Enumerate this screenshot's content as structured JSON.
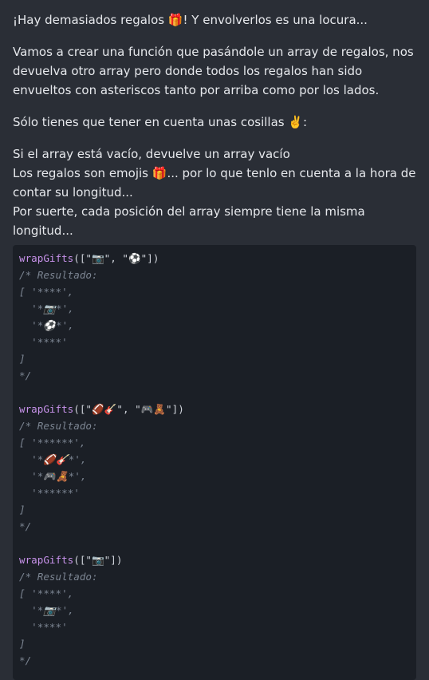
{
  "intro": {
    "title": "¡Hay demasiados regalos 🎁! Y envolverlos es una locura...",
    "description": "Vamos a crear una función que pasándole un array de regalos, nos devuelva otro array pero donde todos los regalos han sido envueltos con asteriscos tanto por arriba como por los lados.",
    "note_heading": "Sólo tienes que tener en cuenta unas cosillas ✌️:"
  },
  "rules": [
    "Si el array está vacío, devuelve un array vacío",
    "Los regalos son emojis 🎁... por lo que tenlo en cuenta a la hora de contar su longitud...",
    "Por suerte, cada posición del array siempre tiene la misma longitud..."
  ],
  "code": {
    "examples": [
      {
        "fn": "wrapGifts",
        "args": "([\"📷\", \"⚽️\"])",
        "result_label": "/* Resultado:",
        "lines": [
          "[ '****',",
          "  '*📷*',",
          "  '*⚽️*',",
          "  '****'",
          "]",
          "*/"
        ]
      },
      {
        "fn": "wrapGifts",
        "args": "([\"🏈🎸\", \"🎮🧸\"])",
        "result_label": "/* Resultado:",
        "lines": [
          "[ '******',",
          "  '*🏈🎸*',",
          "  '*🎮🧸*',",
          "  '******'",
          "]",
          "*/"
        ]
      },
      {
        "fn": "wrapGifts",
        "args": "([\"📷\"])",
        "result_label": "/* Resultado:",
        "lines": [
          "[ '****',",
          "  '*📷*',",
          "  '****'",
          "]",
          "*/"
        ]
      }
    ]
  }
}
